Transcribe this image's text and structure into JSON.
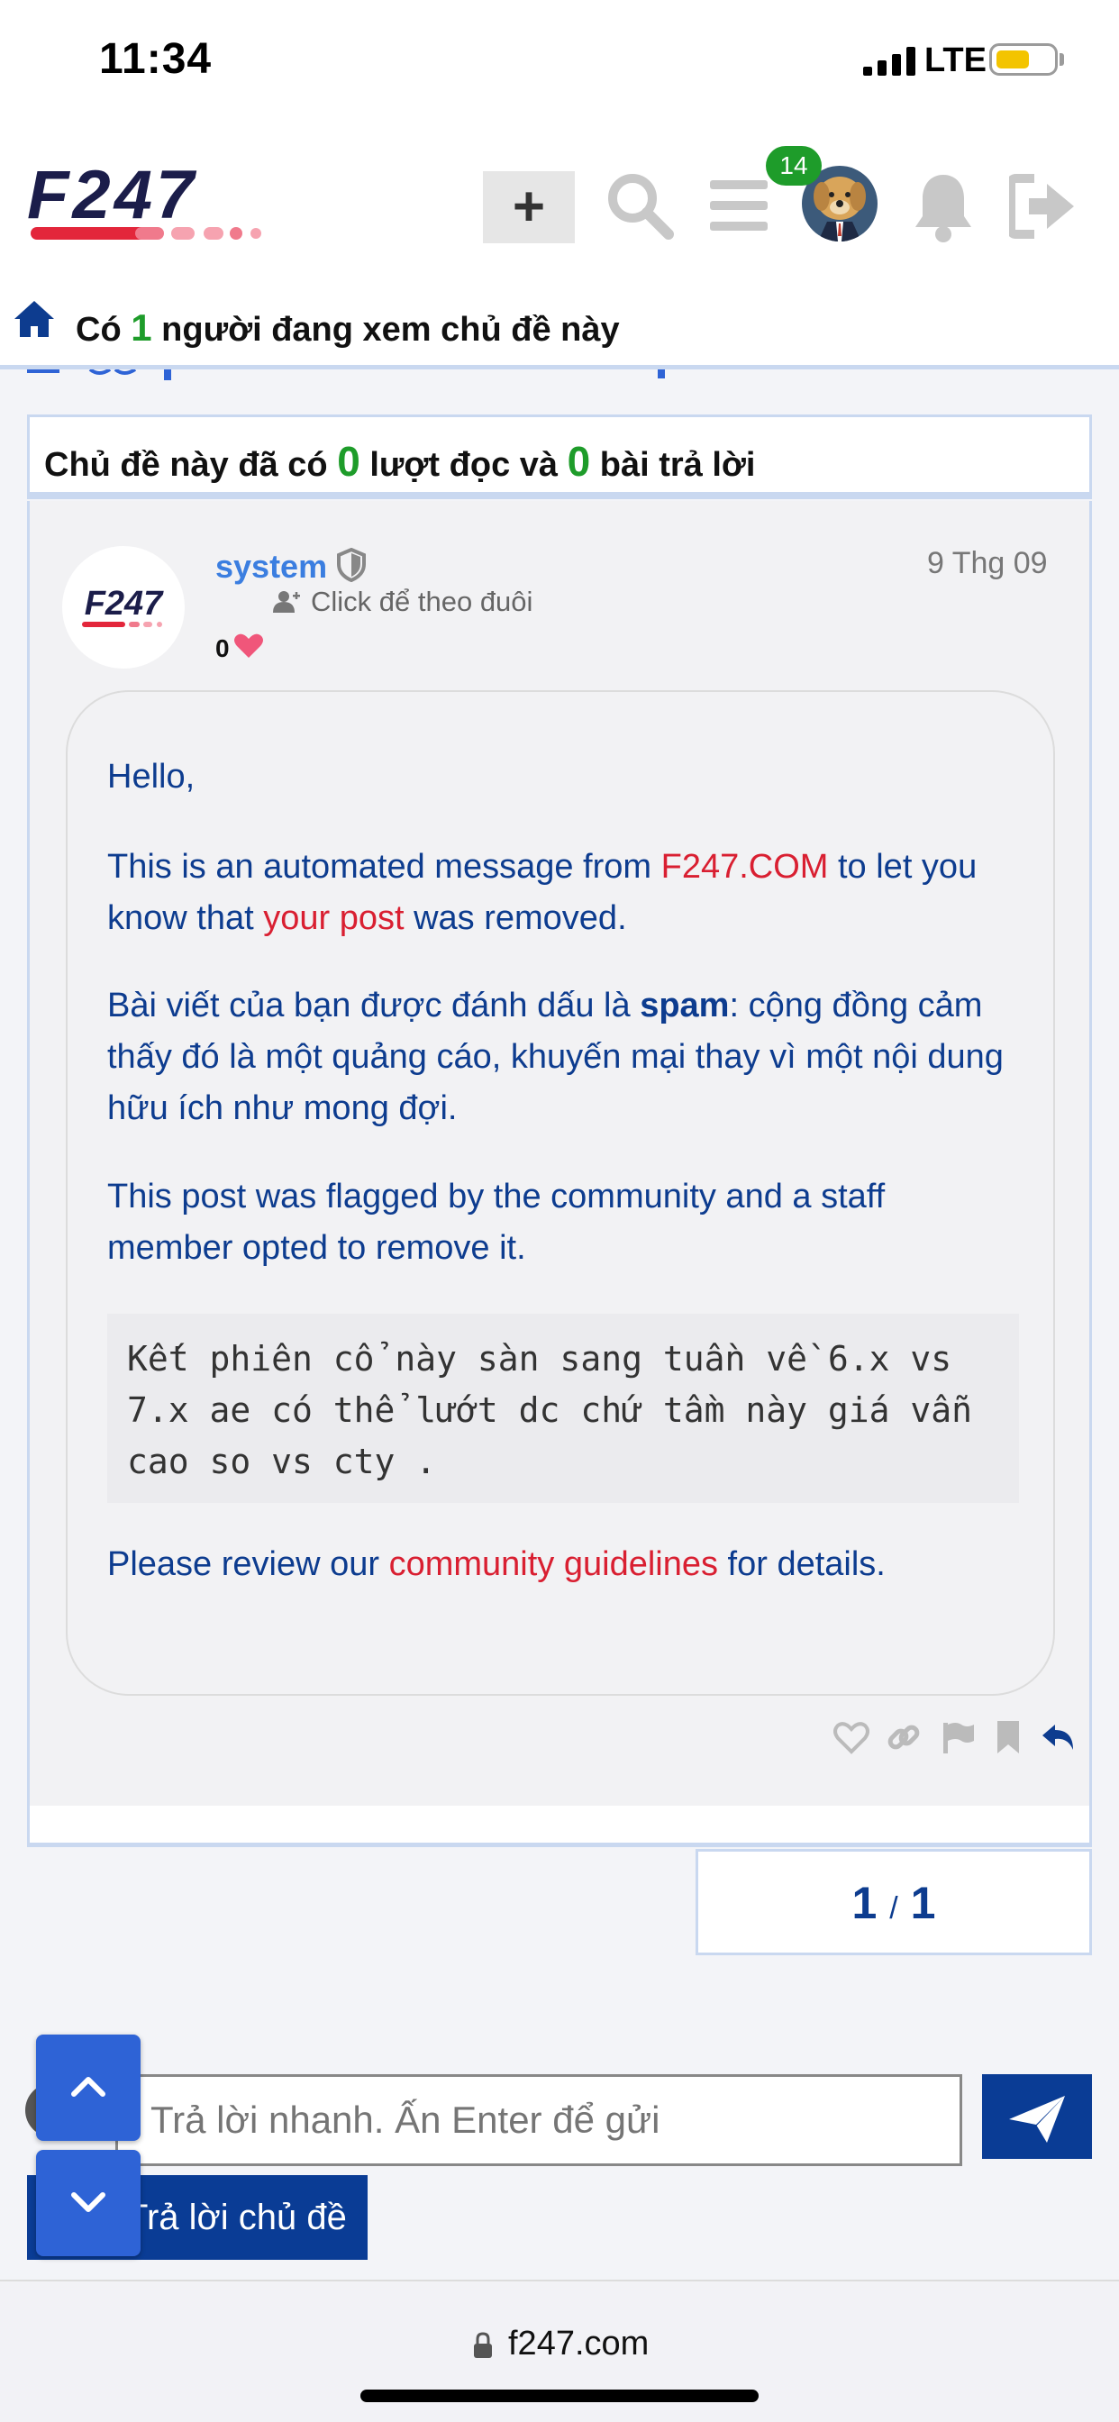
{
  "status_bar": {
    "time": "11:34",
    "network": "LTE"
  },
  "header": {
    "logo_text": "F247",
    "new_topic_label": "+",
    "notification_count": "14"
  },
  "viewing": {
    "prefix": "Có",
    "count": "1",
    "suffix": "người đang xem chủ đề này"
  },
  "stats": {
    "prefix": "Chủ đề này đã có",
    "reads": "0",
    "middle": "lượt đọc và",
    "replies": "0",
    "suffix": "bài trả lời"
  },
  "post": {
    "author": "system",
    "follow_label": "Click để theo đuôi",
    "likes": "0",
    "date": "9 Thg 09",
    "greeting": "Hello,",
    "p1_before": "This is an automated message from ",
    "p1_link": "F247.COM",
    "p1_mid": " to let you know that ",
    "p1_link2": "your post",
    "p1_after": " was removed.",
    "p2_before": "Bài viết của bạn được đánh dấu là ",
    "p2_bold": "spam",
    "p2_after": ": cộng đồng cảm thấy đó là một quảng cáo, khuyến mại thay vì một nội dung hữu ích như mong đợi.",
    "p3": "This post was flagged by the community and a staff member opted to remove it.",
    "quoted": "Kết phiên cổ này sàn sang tuần về 6.x vs 7.x ae có thể lướt dc chứ tầm này giá vẫn cao so vs cty .",
    "p4_before": "Please review our ",
    "p4_link": "community guidelines",
    "p4_after": " for details."
  },
  "pagination": {
    "current": "1",
    "separator": "/",
    "total": "1"
  },
  "quick_reply": {
    "placeholder": "Trả lời nhanh. Ấn Enter để gửi",
    "reply_topic_label": "Trả lời chủ đề"
  },
  "browser": {
    "url": "f247.com"
  },
  "colors": {
    "primary": "#0a3c95",
    "accent_red": "#d91f31",
    "count_green": "#1e9c2a",
    "link_blue": "#3b7ee0"
  }
}
